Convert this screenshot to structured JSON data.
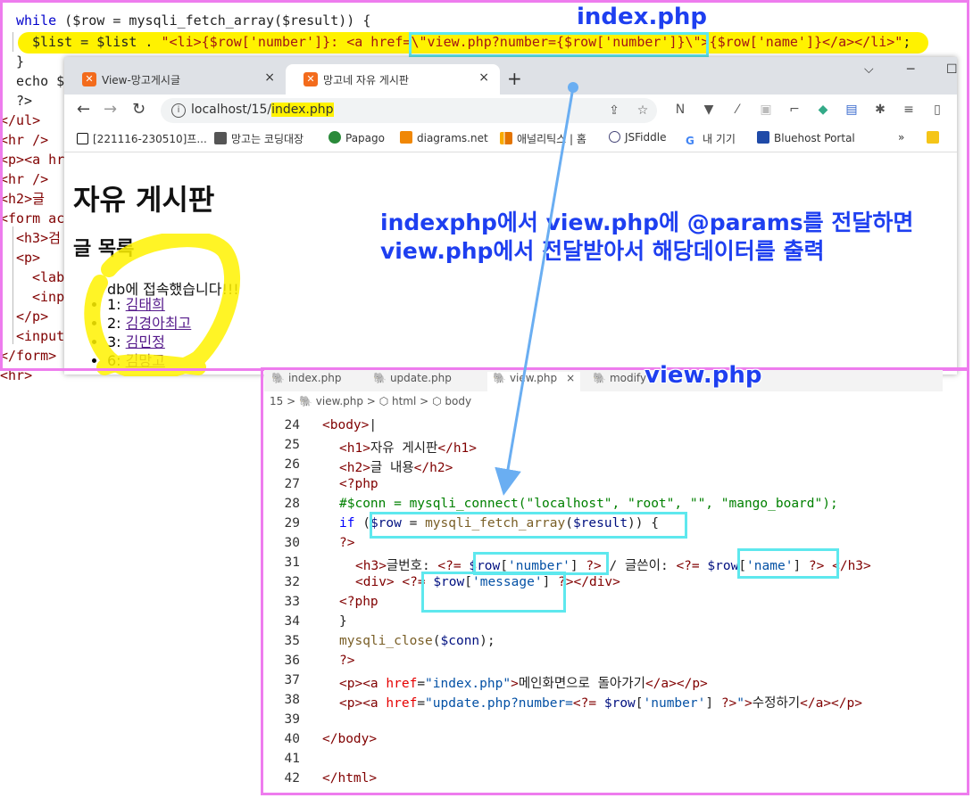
{
  "annotations": {
    "index_label": "index.php",
    "view_label": "view.php",
    "caption_line1": "indexphp에서 view.php에 @params를 전달하면",
    "caption_line2": "view.php에서 전달받아서 해당데이터를 출력"
  },
  "colors": {
    "highlight_yellow": "#fff200",
    "box_cyan": "#5ee8ee",
    "frame_magenta": "#ee7cee",
    "arrow_blue": "#6aaef2",
    "caption_blue": "#1e3ff0"
  },
  "background_code": {
    "line1": "while ($row = mysqli_fetch_array($result)) {",
    "line2": "$list = $list . \"<li>{$row['number']}: <a href=\\\"view.php?number={$row['number']}\\\">{$row['name']}</a></li>\";",
    "line3": "}",
    "line4": "echo $",
    "line5": "?>",
    "line6": "</ul>",
    "line7": "<hr />",
    "line8": "<p><a hr",
    "line9": "<hr />",
    "line10": "<h2>글 ",
    "line11": "<form ac",
    "line12": "<h3>검",
    "line13": "<p>",
    "line14": "<lab",
    "line15": "<inp",
    "line16": "</p>",
    "line17": "<input",
    "line18": "</form>",
    "line19": "<hr>"
  },
  "browser": {
    "tabs": [
      {
        "label": "View-망고게시글",
        "icon": "xampp-icon"
      },
      {
        "label": "망고네 자유 게시판",
        "icon": "xampp-icon",
        "active": true
      }
    ],
    "new_tab": "+",
    "url_prefix": "localhost/15/",
    "url_highlight": "index.php",
    "bookmarks": [
      {
        "label": "[221116-230510]프...",
        "icon": "notion-icon"
      },
      {
        "label": "망고는 코딩대장",
        "icon": "monitor-icon"
      },
      {
        "label": "Papago",
        "icon": "papago-icon"
      },
      {
        "label": "diagrams.net",
        "icon": "diagrams-icon"
      },
      {
        "label": "애널리틱스 | 홈",
        "icon": "analytics-icon"
      },
      {
        "label": "JSFiddle",
        "icon": "jsfiddle-icon"
      },
      {
        "label": "내 기기",
        "icon": "google-icon"
      },
      {
        "label": "Bluehost Portal",
        "icon": "grid-icon"
      }
    ],
    "bookmarks_more": "»",
    "page": {
      "h1": "자유 게시판",
      "h2": "글 목록",
      "db_message": "db에 접속했습니다!!!",
      "items": [
        {
          "num": "1: ",
          "name": "김태희"
        },
        {
          "num": "2: ",
          "name": "김경아최고"
        },
        {
          "num": "3: ",
          "name": "김민정"
        },
        {
          "num": "6: ",
          "name": "김망고"
        }
      ]
    }
  },
  "editor": {
    "tabs": [
      {
        "label": "index.php"
      },
      {
        "label": "update.php"
      },
      {
        "label": "view.php",
        "active": true
      },
      {
        "label": "modify"
      }
    ],
    "breadcrumb": [
      "15",
      ">",
      "view.php",
      ">",
      "html",
      ">",
      "body"
    ],
    "line_numbers": [
      "24",
      "25",
      "26",
      "27",
      "28",
      "29",
      "30",
      "31",
      "32",
      "33",
      "34",
      "35",
      "36",
      "37",
      "38",
      "39",
      "40",
      "41",
      "42"
    ]
  }
}
